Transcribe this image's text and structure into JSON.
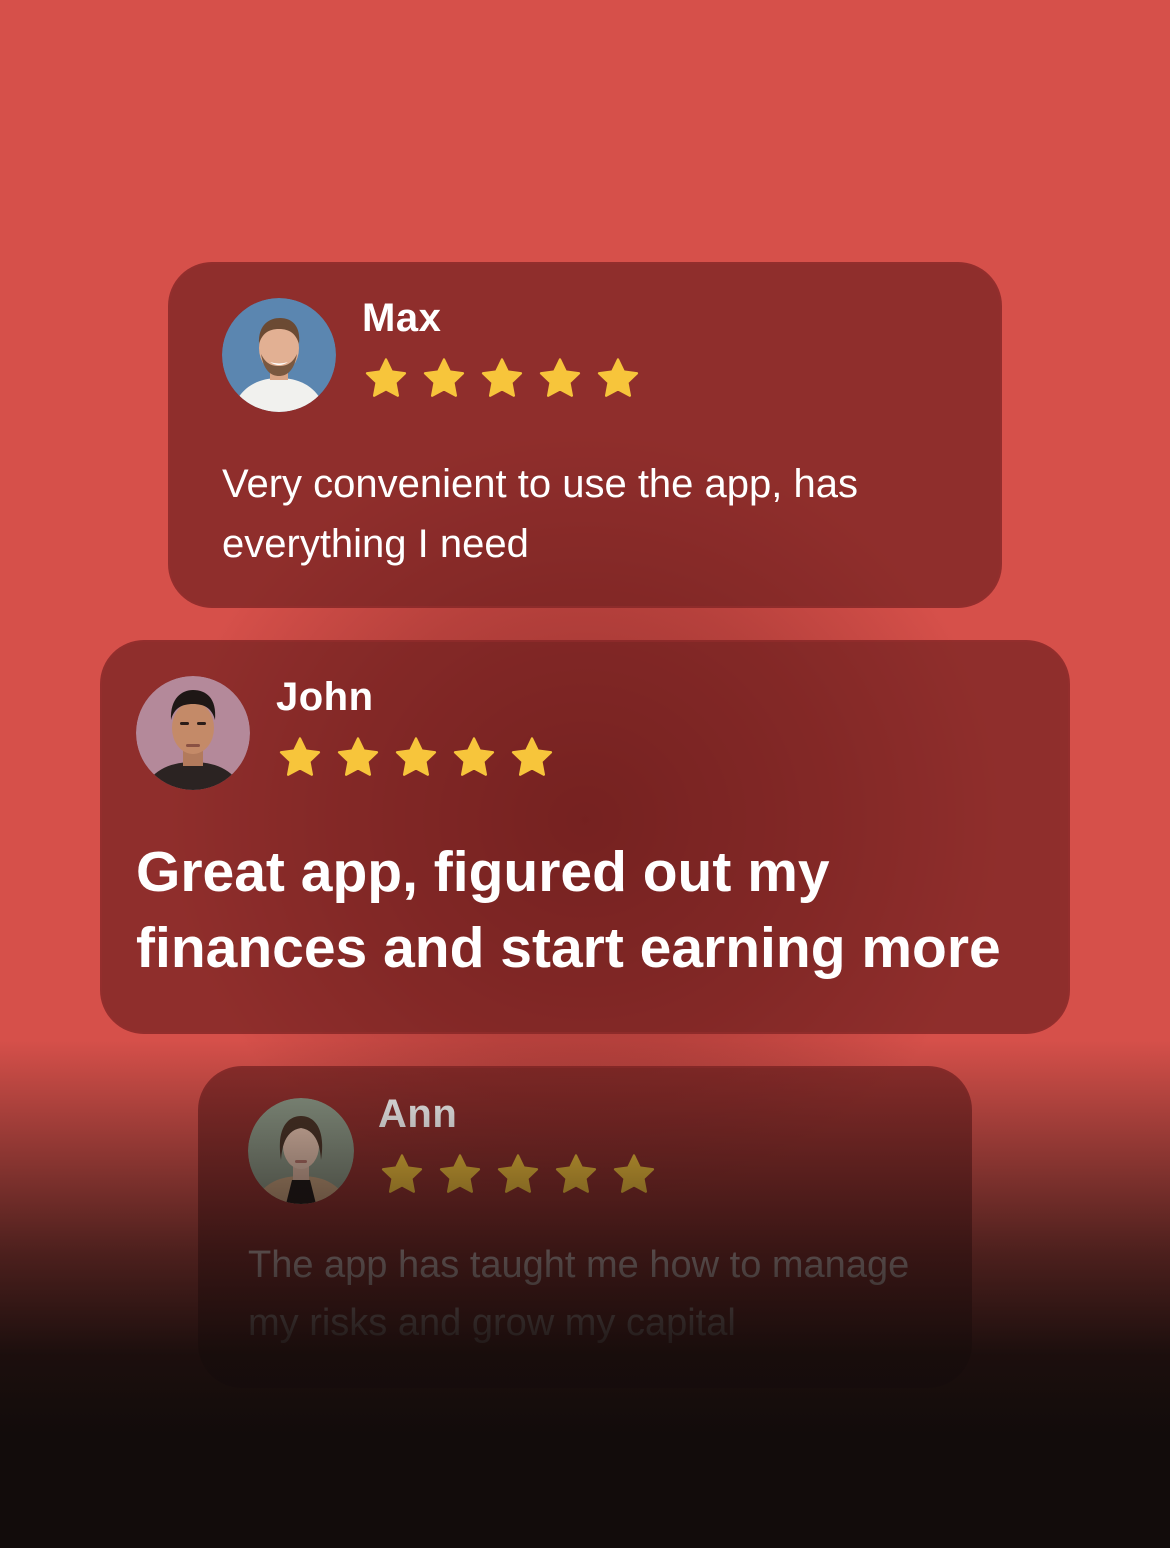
{
  "reviews": [
    {
      "name": "Max",
      "rating": 5,
      "text": "Very convenient to use the app, has everything I need"
    },
    {
      "name": "John",
      "rating": 5,
      "text": "Great app, figured out my finances and start earning more"
    },
    {
      "name": "Ann",
      "rating": 5,
      "text": "The app has taught me how to manage  my risks and grow my capital"
    }
  ],
  "colors": {
    "background": "#d6504a",
    "card": "#641a1a",
    "star": "#f7c53b",
    "bottom_fade": "#120c0b"
  },
  "icons": {
    "rating": "star-icon",
    "profile": "avatar-photo"
  }
}
